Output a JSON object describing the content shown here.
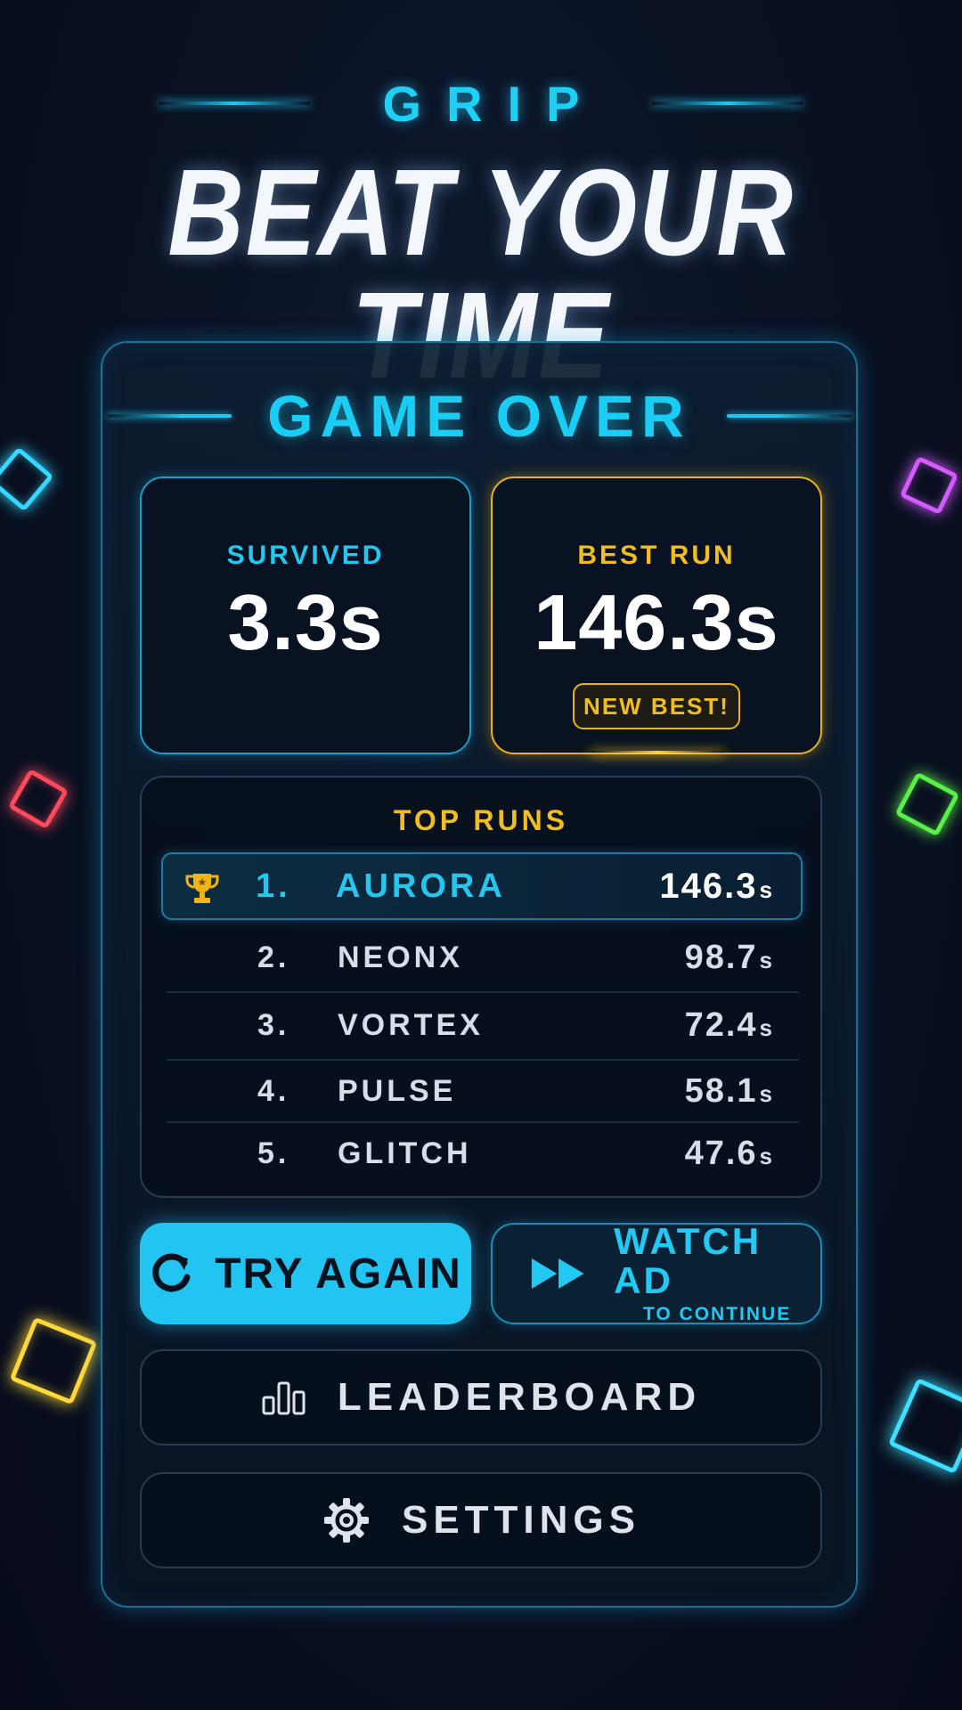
{
  "header": {
    "brand": "GRIP",
    "headline": "BEAT YOUR TIME"
  },
  "panel": {
    "title": "GAME OVER",
    "survived": {
      "label": "SURVIVED",
      "value": "3.3s"
    },
    "best_run": {
      "label": "BEST RUN",
      "value": "146.3s",
      "badge": "NEW BEST!"
    },
    "top_runs": {
      "title": "TOP RUNS",
      "rows": [
        {
          "rank": "1.",
          "name": "AURORA",
          "time": "146.3",
          "unit": "s"
        },
        {
          "rank": "2.",
          "name": "NEONX",
          "time": "98.7",
          "unit": "s"
        },
        {
          "rank": "3.",
          "name": "VORTEX",
          "time": "72.4",
          "unit": "s"
        },
        {
          "rank": "4.",
          "name": "PULSE",
          "time": "58.1",
          "unit": "s"
        },
        {
          "rank": "5.",
          "name": "GLITCH",
          "time": "47.6",
          "unit": "s"
        }
      ]
    },
    "buttons": {
      "try_again": "TRY AGAIN",
      "watch_ad": "WATCH AD",
      "watch_ad_sub": "TO CONTINUE",
      "leaderboard": "LEADERBOARD",
      "settings": "SETTINGS"
    }
  },
  "colors": {
    "accent_cyan": "#22c5f2",
    "accent_gold": "#f2bd1e",
    "background": "#0a1224"
  },
  "icons": {
    "trophy": "trophy-icon",
    "retry": "refresh-icon",
    "watch": "fast-forward-icon",
    "leaderboard": "bar-chart-icon",
    "settings": "gear-icon"
  }
}
